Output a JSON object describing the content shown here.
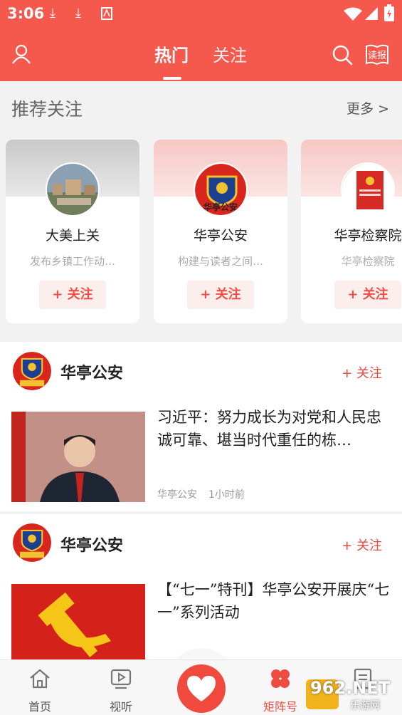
{
  "status_bar": {
    "time": "3:06"
  },
  "header": {
    "tabs": [
      {
        "label": "热门"
      },
      {
        "label": "关注"
      }
    ],
    "read_label": "读报"
  },
  "recommend": {
    "title": "推荐关注",
    "more": "更多 >",
    "cards": [
      {
        "name": "大美上关",
        "desc": "发布乡镇工作动…",
        "follow": "+ 关注"
      },
      {
        "name": "华亭公安",
        "desc": "构建与读者之间…",
        "follow": "+ 关注"
      },
      {
        "name": "华亭检察院",
        "desc": "华亭检察院",
        "follow": "+ 关注"
      }
    ]
  },
  "feed": [
    {
      "source": "华亭公安",
      "follow": "+ 关注",
      "title": "习近平：努力成长为对党和人民忠诚可靠、堪当时代重任的栋…",
      "meta_source": "华亭公安",
      "meta_time": "1小时前"
    },
    {
      "source": "华亭公安",
      "follow": "+ 关注",
      "title": "【“七一”特刊】华亭公安开展庆“七一”系列活动"
    }
  ],
  "badge_text": "华亭公安",
  "bottom_nav": [
    {
      "label": "首页",
      "icon": "home-icon"
    },
    {
      "label": "视听",
      "icon": "video-icon"
    },
    {
      "label": "",
      "icon": "heart-icon"
    },
    {
      "label": "矩阵号",
      "icon": "clover-icon"
    },
    {
      "label": "",
      "icon": "document-icon"
    }
  ],
  "watermark": {
    "text": "962.NET",
    "sub": "乐游网"
  },
  "colors": {
    "brand_red": "#f5584d",
    "accent_red": "#e84a40"
  }
}
